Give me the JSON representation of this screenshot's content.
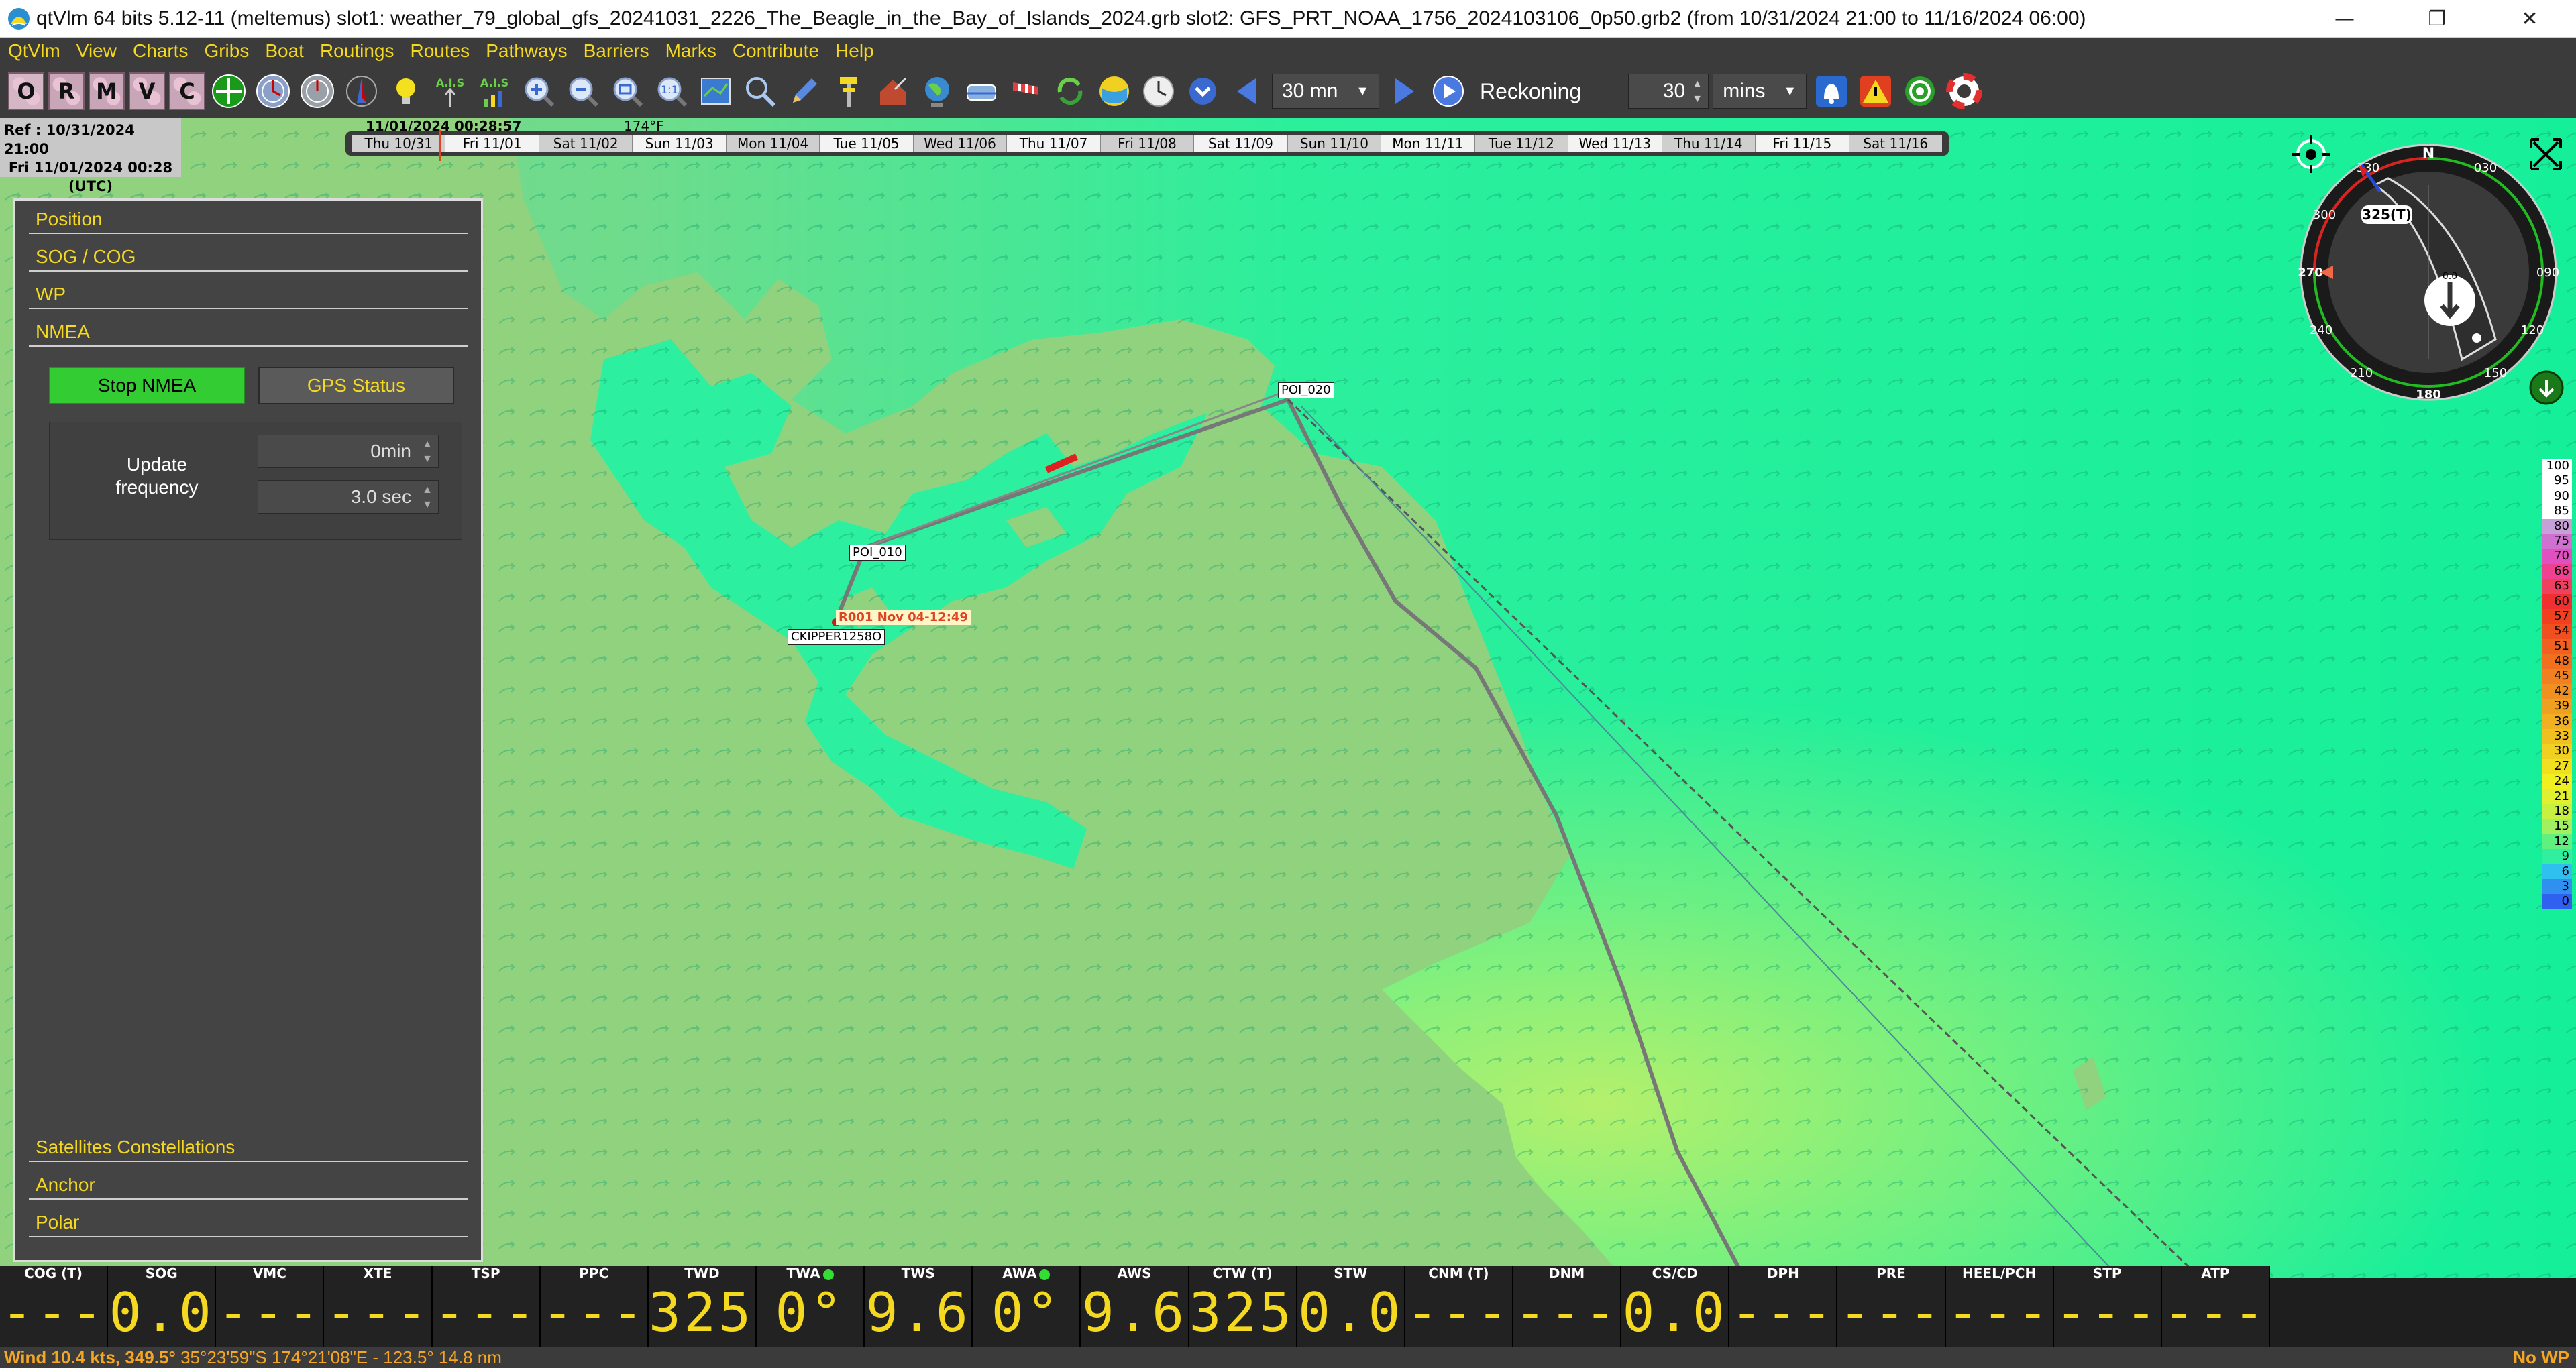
{
  "window": {
    "title": "qtVlm 64 bits 5.12-11 (meltemus) slot1: weather_79_global_gfs_20241031_2226_The_Beagle_in_the_Bay_of_Islands_2024.grb slot2: GFS_PRT_NOAA_1756_2024103106_0p50.grb2 (from 10/31/2024 21:00 to 11/16/2024 06:00)",
    "minimize": "—",
    "maximize": "❐",
    "close": "✕"
  },
  "menu": [
    "QtVlm",
    "View",
    "Charts",
    "Gribs",
    "Boat",
    "Routings",
    "Routes",
    "Pathways",
    "Barriers",
    "Marks",
    "Contribute",
    "Help"
  ],
  "toolbar": {
    "letters": [
      "O",
      "R",
      "M",
      "V",
      "C"
    ],
    "ais1": "A.I.S",
    "ais2": "A.I.S",
    "step_value": "30 mn",
    "reckoning_label": "Reckoning",
    "reckoning_value": "30",
    "unit_value": "mins"
  },
  "timeline": {
    "ref_line1": "Ref : 10/31/2024 21:00",
    "ref_line2": "Fri 11/01/2024 00:28",
    "ref_line3": "(UTC)",
    "cursor_date": "11/01/2024 00:28:57",
    "temp": "174°F",
    "days": [
      "Thu 10/31",
      "Fri 11/01",
      "Sat 11/02",
      "Sun 11/03",
      "Mon 11/04",
      "Tue 11/05",
      "Wed 11/06",
      "Thu 11/07",
      "Fri 11/08",
      "Sat 11/09",
      "Sun 11/10",
      "Mon 11/11",
      "Tue 11/12",
      "Wed 11/13",
      "Thu 11/14",
      "Fri 11/15",
      "Sat 11/16"
    ]
  },
  "dock": {
    "sections_top": [
      "Position",
      "SOG / COG",
      "WP",
      "NMEA"
    ],
    "stop_nmea": "Stop NMEA",
    "gps_status": "GPS Status",
    "update_label_1": "Update",
    "update_label_2": "frequency",
    "freq_min": "0min",
    "freq_sec": "3.0 sec",
    "sections_bottom": [
      "Satellites Constellations",
      "Anchor",
      "Polar"
    ]
  },
  "map": {
    "poi_020": "POI_020",
    "poi_010": "POI_010",
    "route_label": "R001 Nov 04-12:49",
    "boat_label": "CKIPPER1258O"
  },
  "compass": {
    "north": "N",
    "ticks": [
      "030",
      "090",
      "120",
      "150",
      "180",
      "210",
      "240",
      "270",
      "300",
      "330"
    ],
    "heading": "325(T)",
    "speed": "0.0"
  },
  "wind_scale": [
    {
      "v": "100",
      "c": "#ffffff"
    },
    {
      "v": "95",
      "c": "#ffffff"
    },
    {
      "v": "90",
      "c": "#ffffff"
    },
    {
      "v": "85",
      "c": "#ffffff"
    },
    {
      "v": "80",
      "c": "#c8a0d8"
    },
    {
      "v": "75",
      "c": "#d070d0"
    },
    {
      "v": "70",
      "c": "#e050c0"
    },
    {
      "v": "66",
      "c": "#f04090"
    },
    {
      "v": "63",
      "c": "#f04060"
    },
    {
      "v": "60",
      "c": "#f03030"
    },
    {
      "v": "57",
      "c": "#f04020"
    },
    {
      "v": "54",
      "c": "#f05020"
    },
    {
      "v": "51",
      "c": "#f06020"
    },
    {
      "v": "48",
      "c": "#f07020"
    },
    {
      "v": "45",
      "c": "#f08020"
    },
    {
      "v": "42",
      "c": "#f09020"
    },
    {
      "v": "39",
      "c": "#f0a020"
    },
    {
      "v": "36",
      "c": "#f0b020"
    },
    {
      "v": "33",
      "c": "#f0c020"
    },
    {
      "v": "30",
      "c": "#f0d020"
    },
    {
      "v": "27",
      "c": "#f0e020"
    },
    {
      "v": "24",
      "c": "#f0f020"
    },
    {
      "v": "21",
      "c": "#e0f030"
    },
    {
      "v": "18",
      "c": "#c8f040"
    },
    {
      "v": "15",
      "c": "#a0f060"
    },
    {
      "v": "12",
      "c": "#60f080"
    },
    {
      "v": "9",
      "c": "#30f0a0"
    },
    {
      "v": "6",
      "c": "#30c0f0"
    },
    {
      "v": "3",
      "c": "#3090f0"
    },
    {
      "v": "0",
      "c": "#3060f0"
    }
  ],
  "instruments": [
    {
      "label": "COG (T)",
      "value": "----"
    },
    {
      "label": "SOG",
      "value": "0.0"
    },
    {
      "label": "VMC",
      "value": "----"
    },
    {
      "label": "XTE",
      "value": "----"
    },
    {
      "label": "TSP",
      "value": "---"
    },
    {
      "label": "PPC",
      "value": "---"
    },
    {
      "label": "TWD",
      "value": "325°"
    },
    {
      "label": "TWA",
      "value": "0°",
      "dot": true
    },
    {
      "label": "TWS",
      "value": "9.6"
    },
    {
      "label": "AWA",
      "value": "0°",
      "dot": true
    },
    {
      "label": "AWS",
      "value": "9.6"
    },
    {
      "label": "CTW (T)",
      "value": "325°"
    },
    {
      "label": "STW",
      "value": "0.0"
    },
    {
      "label": "CNM (T)",
      "value": "----"
    },
    {
      "label": "DNM",
      "value": "----"
    },
    {
      "label": "CS/CD",
      "value": "0.0"
    },
    {
      "label": "DPH",
      "value": "----"
    },
    {
      "label": "PRE",
      "value": "----"
    },
    {
      "label": "HEEL/PCH",
      "value": "----"
    },
    {
      "label": "STP",
      "value": "----"
    },
    {
      "label": "ATP",
      "value": "----"
    }
  ],
  "status": {
    "wind": "Wind 10.4 kts, 349.5°",
    "coords": "35°23'59\"S 174°21'08\"E - 123.5° 14.8 nm",
    "no_wp": "No WP"
  },
  "colors": {
    "accent": "#f5d820",
    "panel": "#444444",
    "sea": "#1cf0a0",
    "land": "#8fd080"
  }
}
